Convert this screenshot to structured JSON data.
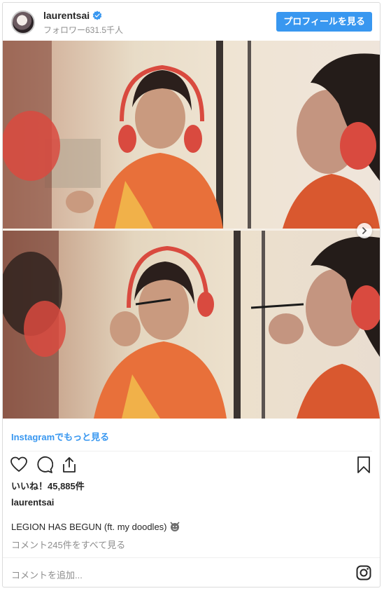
{
  "header": {
    "username": "laurentsai",
    "followers": "フォロワー631.5千人",
    "profile_button": "プロフィールを見る"
  },
  "media": {
    "frames": 2
  },
  "more_link": "Instagramでもっと見る",
  "actions": {
    "like_icon": "heart-icon",
    "comment_icon": "comment-icon",
    "share_icon": "share-icon",
    "save_icon": "bookmark-icon"
  },
  "likes": "いいね！45,885件",
  "owner": "laurentsai",
  "caption": {
    "text": "LEGION HAS BEGUN (ft. my doodles)"
  },
  "comments_link": "コメント245件をすべて見る",
  "add_comment_placeholder": "コメントを追加...",
  "colors": {
    "accent": "#3897f0",
    "headphones": "#d94a3f",
    "shirt": "#e8703a"
  }
}
